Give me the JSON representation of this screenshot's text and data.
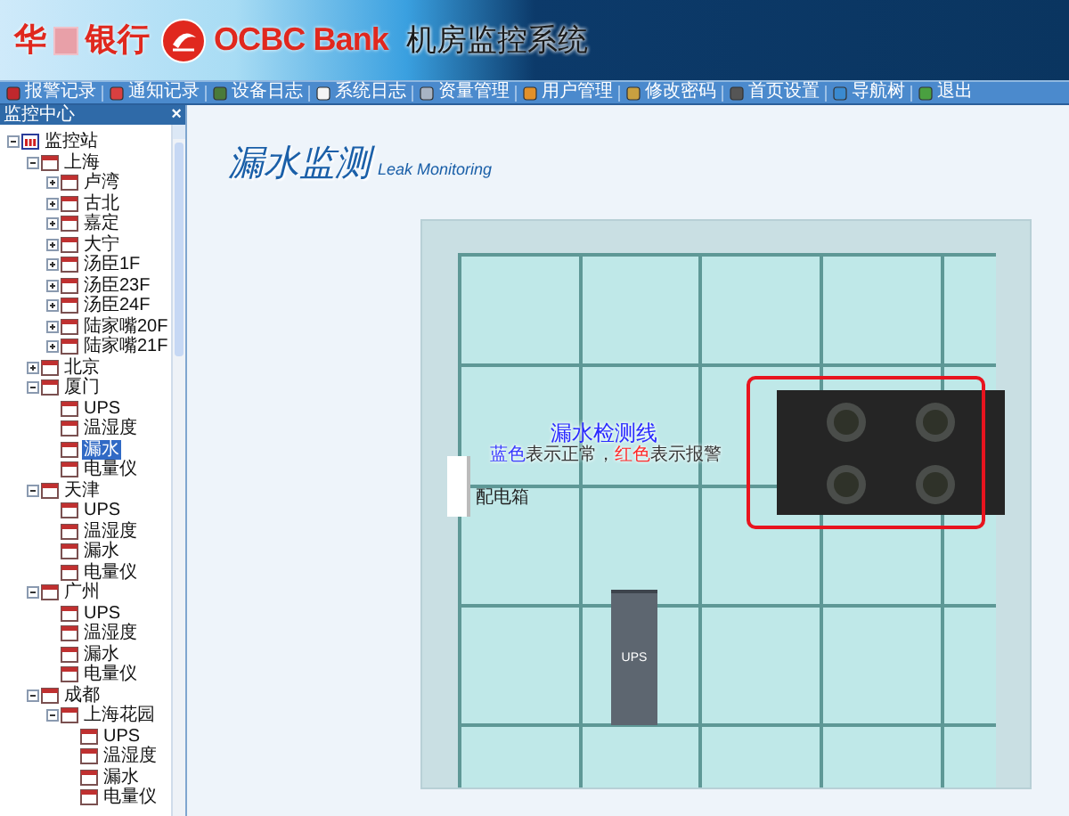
{
  "header": {
    "bank_name_start": "华",
    "bank_name_end": "银行",
    "brand": "OCBC Bank",
    "system_title": "机房监控系统"
  },
  "toolbar": [
    {
      "label": "报警记录"
    },
    {
      "label": "通知记录"
    },
    {
      "label": "设备日志"
    },
    {
      "label": "系统日志"
    },
    {
      "label": "资量管理"
    },
    {
      "label": "用户管理"
    },
    {
      "label": "修改密码"
    },
    {
      "label": "首页设置"
    },
    {
      "label": "导航树"
    },
    {
      "label": "退出"
    }
  ],
  "sidebar": {
    "title": "监控中心",
    "close": "×",
    "tree": [
      {
        "label": "监控站",
        "expanded": true,
        "selected": false,
        "children": [
          {
            "label": "上海",
            "expanded": true,
            "selected": false,
            "children": [
              {
                "label": "卢湾",
                "expanded": false,
                "selected": false
              },
              {
                "label": "古北",
                "expanded": false,
                "selected": false
              },
              {
                "label": "嘉定",
                "expanded": false,
                "selected": false
              },
              {
                "label": "大宁",
                "expanded": false,
                "selected": false
              },
              {
                "label": "汤臣1F",
                "expanded": false,
                "selected": false
              },
              {
                "label": "汤臣23F",
                "expanded": false,
                "selected": false
              },
              {
                "label": "汤臣24F",
                "expanded": false,
                "selected": false
              },
              {
                "label": "陆家嘴20F",
                "expanded": false,
                "selected": false
              },
              {
                "label": "陆家嘴21F",
                "expanded": false,
                "selected": false
              }
            ]
          },
          {
            "label": "北京",
            "expanded": false,
            "selected": false
          },
          {
            "label": "厦门",
            "expanded": true,
            "selected": false,
            "children": [
              {
                "label": "UPS",
                "selected": false
              },
              {
                "label": "温湿度",
                "selected": false
              },
              {
                "label": "漏水",
                "selected": true
              },
              {
                "label": "电量仪",
                "selected": false
              }
            ]
          },
          {
            "label": "天津",
            "expanded": true,
            "selected": false,
            "children": [
              {
                "label": "UPS",
                "selected": false
              },
              {
                "label": "温湿度",
                "selected": false
              },
              {
                "label": "漏水",
                "selected": false
              },
              {
                "label": "电量仪",
                "selected": false
              }
            ]
          },
          {
            "label": "广州",
            "expanded": true,
            "selected": false,
            "children": [
              {
                "label": "UPS",
                "selected": false
              },
              {
                "label": "温湿度",
                "selected": false
              },
              {
                "label": "漏水",
                "selected": false
              },
              {
                "label": "电量仪",
                "selected": false
              }
            ]
          },
          {
            "label": "成都",
            "expanded": true,
            "selected": false,
            "children": [
              {
                "label": "上海花园",
                "expanded": true,
                "selected": false,
                "children": [
                  {
                    "label": "UPS",
                    "selected": false
                  },
                  {
                    "label": "温湿度",
                    "selected": false
                  },
                  {
                    "label": "漏水",
                    "selected": false
                  },
                  {
                    "label": "电量仪",
                    "selected": false
                  }
                ]
              }
            ]
          }
        ]
      }
    ]
  },
  "main": {
    "title": "漏水监测",
    "subtitle": "Leak Monitoring",
    "floor_plan": {
      "sensor_label": "漏水检测线",
      "legend": [
        {
          "text": "蓝色",
          "color": "#3a3aff"
        },
        {
          "text": "表示正常，",
          "color": "#333333"
        },
        {
          "text": "红色",
          "color": "#ff2a2a"
        },
        {
          "text": "表示报警",
          "color": "#333333"
        }
      ],
      "power_box_label": "配电箱",
      "ups_label": "UPS"
    }
  }
}
